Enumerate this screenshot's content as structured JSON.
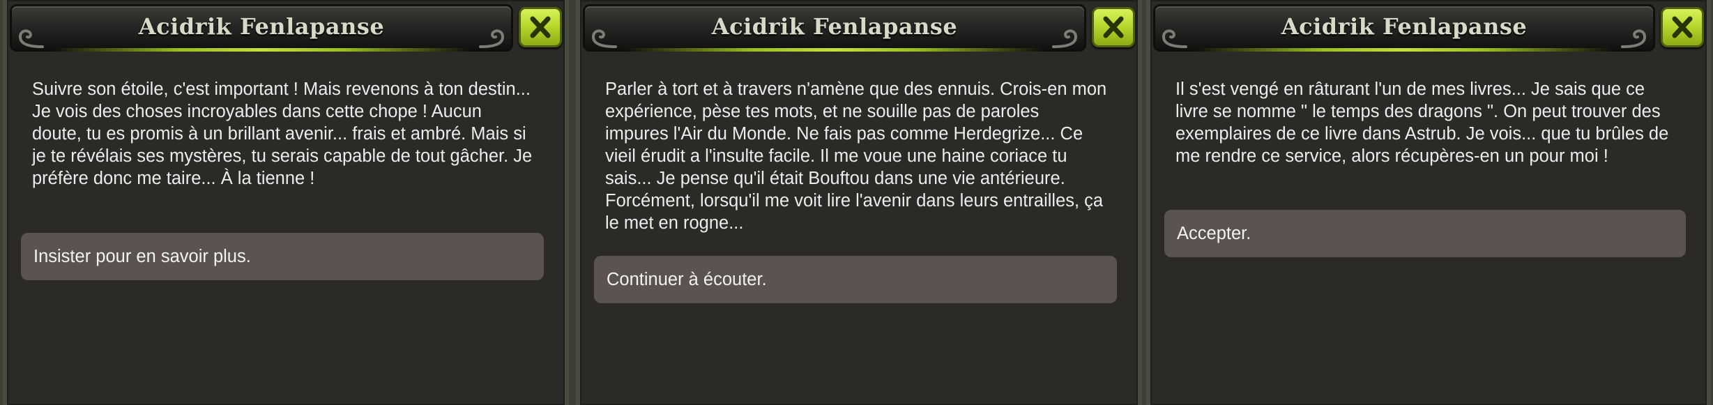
{
  "dialogs": [
    {
      "npc_name": "Acidrik Fenlapanse",
      "text": "Suivre son étoile, c'est important ! Mais revenons à ton destin... Je vois des choses incroyables dans cette chope ! Aucun doute, tu es promis à un brillant avenir... frais et ambré. Mais si je te révélais ses mystères, tu serais capable de tout gâcher. Je préfère donc me taire... À la tienne !",
      "reply": "Insister pour en savoir plus."
    },
    {
      "npc_name": "Acidrik Fenlapanse",
      "text": "Parler à tort et à travers n'amène que des ennuis. Crois-en mon expérience, pèse tes mots, et ne souille pas de paroles impures l'Air du Monde. Ne fais pas comme Herdegrize... Ce vieil érudit a l'insulte facile. Il me voue une haine coriace tu sais... Je pense qu'il était Bouftou dans une vie antérieure. Forcément, lorsqu'il me voit lire l'avenir dans leurs entrailles, ça le met en rogne...",
      "reply": "Continuer à écouter."
    },
    {
      "npc_name": "Acidrik Fenlapanse",
      "text": "Il s'est vengé en râturant l'un de mes livres... Je sais que ce livre se nomme \" le temps des dragons \". On peut trouver des exemplaires de ce livre dans Astrub. Je vois... que tu brûles de me rendre ce service, alors récupères-en un pour moi !",
      "reply": "Accepter."
    }
  ],
  "colors": {
    "accent_green": "#b4d62a",
    "panel_bg": "#2b2a27",
    "reply_bg": "#5a5350",
    "title_text": "#d9d9c8"
  },
  "icons": {
    "close": "close-x-icon",
    "ornament": "swirl-ornament-icon"
  }
}
